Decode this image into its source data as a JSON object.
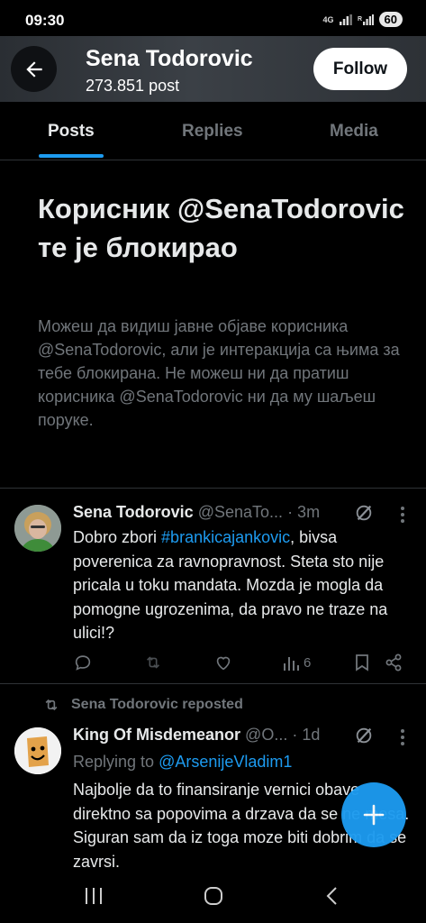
{
  "status_bar": {
    "time": "09:30",
    "network": "4G",
    "battery": "60"
  },
  "header": {
    "name": "Sena Todorovic",
    "post_count": "273.851 post",
    "follow_label": "Follow"
  },
  "tabs": [
    {
      "label": "Posts",
      "active": true
    },
    {
      "label": "Replies",
      "active": false
    },
    {
      "label": "Media",
      "active": false
    }
  ],
  "blocked": {
    "title": "Корисник @SenaTodorovic те је блокирао",
    "description": "Можеш да видиш јавне објаве корисника @SenaTodorovic,  али је интеракција са њима за тебе блокирана. Не можеш ни да пратиш корисника @SenaTodorovic ни да му шаљеш поруке."
  },
  "post1": {
    "name": "Sena Todorovic",
    "handle": "@SenaTo...",
    "time": "· 3m",
    "text_before": "Dobro zbori ",
    "hashtag": "#brankicajankovic",
    "text_after": ", bivsa poverenica za ravnopravnost. Steta sto nije pricala u toku mandata. Mozda je mogla da pomogne ugrozenima, da pravo ne traze na ulici!?",
    "views": "6"
  },
  "repost": {
    "label": "Sena Todorovic reposted"
  },
  "post2": {
    "name": "King Of Misdemeanor",
    "handle": "@O...",
    "time": "· 1d",
    "replying_prefix": "Replying to ",
    "replying_to": "@ArsenijeVladim1",
    "text": "Najbolje da to finansiranje vernici obave direktno sa popovima a drzava da se ne mesa. Siguran sam da iz toga moze biti dobrim da se zavrsi."
  },
  "icons": {
    "back": "arrow-left-icon",
    "more": "more-vertical-icon",
    "reply": "reply-icon",
    "retweet": "retweet-icon",
    "like": "heart-icon",
    "views": "views-icon",
    "bookmark": "bookmark-icon",
    "share": "share-icon",
    "compose": "plus-icon",
    "grok": "grok-icon"
  },
  "colors": {
    "accent": "#1d9bf0",
    "muted": "#71767b",
    "background": "#000000"
  }
}
